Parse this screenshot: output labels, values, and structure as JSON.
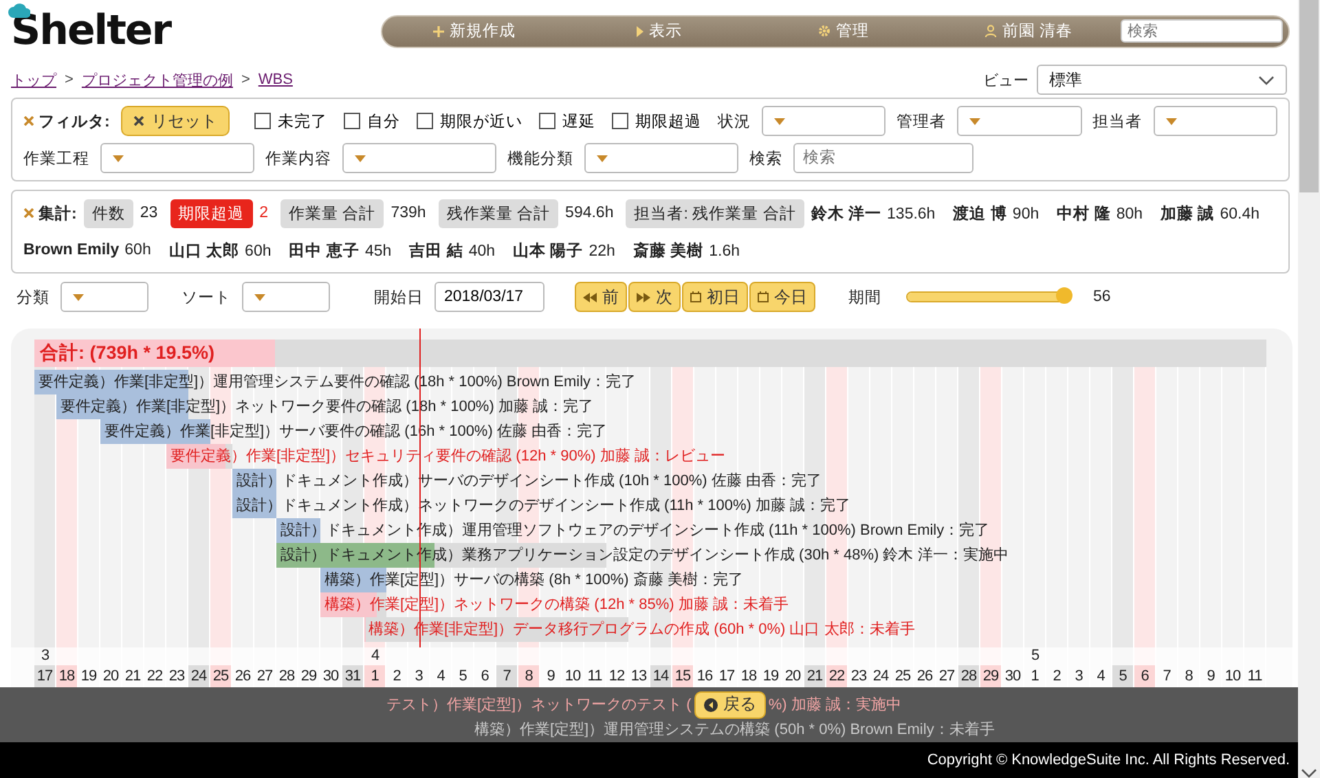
{
  "header": {
    "logo": "Shelter",
    "nav": [
      {
        "kind": "plus",
        "label": "新規作成"
      },
      {
        "kind": "arrow",
        "label": "表示"
      },
      {
        "kind": "gear",
        "label": "管理"
      },
      {
        "kind": "user",
        "label": "前園 清春"
      }
    ],
    "search": {
      "placeholder": "検索"
    }
  },
  "breadcrumb": {
    "items": [
      "トップ",
      "プロジェクト管理の例",
      "WBS"
    ],
    "separators": [
      ">",
      ">"
    ]
  },
  "view": {
    "label": "ビュー",
    "value": "標準"
  },
  "filter": {
    "title": "フィルタ:",
    "reset": "リセット",
    "checkboxes": [
      {
        "label": "未完了",
        "checked": false
      },
      {
        "label": "自分",
        "checked": false
      },
      {
        "label": "期限が近い",
        "checked": false
      },
      {
        "label": "遅延",
        "checked": false
      },
      {
        "label": "期限超過",
        "checked": false
      }
    ],
    "row1_selects": [
      {
        "label": "状況"
      },
      {
        "label": "管理者"
      },
      {
        "label": "担当者"
      }
    ],
    "row2_selects": [
      {
        "label": "作業工程"
      },
      {
        "label": "作業内容"
      },
      {
        "label": "機能分類"
      }
    ],
    "search": {
      "label": "検索",
      "placeholder": "検索"
    }
  },
  "summary": {
    "title": "集計:",
    "items": [
      {
        "kind": "normal",
        "label": "件数",
        "value": "23"
      },
      {
        "kind": "alert",
        "label": "期限超過",
        "value": "2"
      },
      {
        "kind": "normal",
        "label": "作業量 合計",
        "value": "739h"
      },
      {
        "kind": "normal",
        "label": "残作業量 合計",
        "value": "594.6h"
      }
    ],
    "people_label": "担当者: 残作業量 合計",
    "people": [
      {
        "name": "鈴木 洋一",
        "hours": "135.6h"
      },
      {
        "name": "渡迫 博",
        "hours": "90h"
      },
      {
        "name": "中村 隆",
        "hours": "80h"
      },
      {
        "name": "加藤 誠",
        "hours": "60.4h"
      },
      {
        "name": "Brown Emily",
        "hours": "60h"
      },
      {
        "name": "山口 太郎",
        "hours": "60h"
      },
      {
        "name": "田中 恵子",
        "hours": "45h"
      },
      {
        "name": "吉田 結",
        "hours": "40h"
      },
      {
        "name": "山本 陽子",
        "hours": "22h"
      },
      {
        "name": "斎藤 美樹",
        "hours": "1.6h"
      }
    ]
  },
  "controls": {
    "selects": [
      {
        "label": "分類"
      },
      {
        "label": "ソート"
      }
    ],
    "start_date": {
      "label": "開始日",
      "value": "2018/03/17"
    },
    "buttons": [
      {
        "kind": "prev",
        "label": "前"
      },
      {
        "kind": "next",
        "label": "次"
      },
      {
        "kind": "calendar",
        "label": "初日"
      },
      {
        "kind": "calendar",
        "label": "今日"
      }
    ],
    "period": {
      "label": "期間",
      "level": 1,
      "reading": "56"
    }
  },
  "gantt": {
    "total": {
      "label": "合計: (739h * 19.5%)",
      "level": 0.195
    },
    "rows": [
      {
        "text": "要件定義）作業[非定型]）運用管理システム要件の確認 (18h * 100%) Brown Emily：完了",
        "level": 1,
        "late": false
      },
      {
        "text": "要件定義）作業[非定型]）ネットワーク要件の確認 (18h * 100%) 加藤 誠：完了",
        "level": 1,
        "late": false
      },
      {
        "text": "要件定義）作業[非定型]）サーバ要件の確認 (16h * 100%) 佐藤 由香：完了",
        "level": 1,
        "late": false
      },
      {
        "text": "要件定義）作業[非定型]）セキュリティ要件の確認 (12h * 90%) 加藤 誠：レビュー",
        "level": 0.9,
        "late": true
      },
      {
        "text": "設計）ドキュメント作成）サーバのデザインシート作成 (10h * 100%) 佐藤 由香：完了",
        "level": 1,
        "late": false
      },
      {
        "text": "設計）ドキュメント作成）ネットワークのデザインシート作成 (11h * 100%) 加藤 誠：完了",
        "level": 1,
        "late": false
      },
      {
        "text": "設計）ドキュメント作成）運用管理ソフトウェアのデザインシート作成 (11h * 100%) Brown Emily：完了",
        "level": 1,
        "late": false
      },
      {
        "text": "設計）ドキュメント作成）業務アプリケーション設定のデザインシート作成 (30h * 48%) 鈴木 洋一：実施中",
        "level": 0.48,
        "late": false
      },
      {
        "text": "構築）作業[定型]）サーバの構築 (8h * 100%) 斎藤 美樹：完了",
        "level": 1,
        "late": false
      },
      {
        "text": "構築）作業[定型]）ネットワークの構築 (12h * 85%) 加藤 誠：未着手",
        "level": 0.85,
        "late": true
      },
      {
        "text": "構築）作業[非定型]）データ移行プログラムの作成 (60h * 0%) 山口 太郎：未着手",
        "level": 0,
        "late": true
      }
    ],
    "days": [
      {
        "label": "17",
        "kind": "saturday",
        "month": "3"
      },
      {
        "label": "18",
        "kind": "holiday"
      },
      {
        "label": "19",
        "kind": "weekday"
      },
      {
        "label": "20",
        "kind": "weekday"
      },
      {
        "label": "21",
        "kind": "weekday"
      },
      {
        "label": "22",
        "kind": "weekday"
      },
      {
        "label": "23",
        "kind": "weekday"
      },
      {
        "label": "24",
        "kind": "saturday"
      },
      {
        "label": "25",
        "kind": "holiday"
      },
      {
        "label": "26",
        "kind": "weekday"
      },
      {
        "label": "27",
        "kind": "weekday"
      },
      {
        "label": "28",
        "kind": "weekday"
      },
      {
        "label": "29",
        "kind": "weekday"
      },
      {
        "label": "30",
        "kind": "weekday"
      },
      {
        "label": "31",
        "kind": "saturday"
      },
      {
        "label": "1",
        "kind": "holiday",
        "month": "4"
      },
      {
        "label": "2",
        "kind": "weekday"
      },
      {
        "label": "3",
        "kind": "weekday"
      },
      {
        "label": "4",
        "kind": "weekday"
      },
      {
        "label": "5",
        "kind": "weekday"
      },
      {
        "label": "6",
        "kind": "weekday"
      },
      {
        "label": "7",
        "kind": "saturday"
      },
      {
        "label": "8",
        "kind": "holiday"
      },
      {
        "label": "9",
        "kind": "weekday"
      },
      {
        "label": "10",
        "kind": "weekday"
      },
      {
        "label": "11",
        "kind": "weekday"
      },
      {
        "label": "12",
        "kind": "weekday"
      },
      {
        "label": "13",
        "kind": "weekday"
      },
      {
        "label": "14",
        "kind": "saturday"
      },
      {
        "label": "15",
        "kind": "holiday"
      },
      {
        "label": "16",
        "kind": "weekday"
      },
      {
        "label": "17",
        "kind": "weekday"
      },
      {
        "label": "18",
        "kind": "weekday"
      },
      {
        "label": "19",
        "kind": "weekday"
      },
      {
        "label": "20",
        "kind": "weekday"
      },
      {
        "label": "21",
        "kind": "saturday"
      },
      {
        "label": "22",
        "kind": "holiday"
      },
      {
        "label": "23",
        "kind": "weekday"
      },
      {
        "label": "24",
        "kind": "weekday"
      },
      {
        "label": "25",
        "kind": "weekday"
      },
      {
        "label": "26",
        "kind": "weekday"
      },
      {
        "label": "27",
        "kind": "weekday"
      },
      {
        "label": "28",
        "kind": "saturday"
      },
      {
        "label": "29",
        "kind": "holiday"
      },
      {
        "label": "30",
        "kind": "weekday"
      },
      {
        "label": "1",
        "kind": "weekday",
        "month": "5"
      },
      {
        "label": "2",
        "kind": "weekday"
      },
      {
        "label": "3",
        "kind": "weekday"
      },
      {
        "label": "4",
        "kind": "weekday"
      },
      {
        "label": "5",
        "kind": "saturday"
      },
      {
        "label": "6",
        "kind": "holiday"
      },
      {
        "label": "7",
        "kind": "weekday"
      },
      {
        "label": "8",
        "kind": "weekday"
      },
      {
        "label": "9",
        "kind": "weekday"
      },
      {
        "label": "10",
        "kind": "weekday"
      },
      {
        "label": "11",
        "kind": "weekday"
      }
    ]
  },
  "overlay": {
    "back": "戻る",
    "split_row": {
      "before": "テスト）作業[定型]）ネットワークのテスト (",
      "after": "%) 加藤 誠：実施中"
    },
    "cut_row": {
      "text": "構築）作業[定型]）運用管理システムの構築 (50h * 0%) Brown Emily：未着手"
    }
  },
  "footer": "Copyright © KnowledgeSuite Inc. All Rights Reserved."
}
